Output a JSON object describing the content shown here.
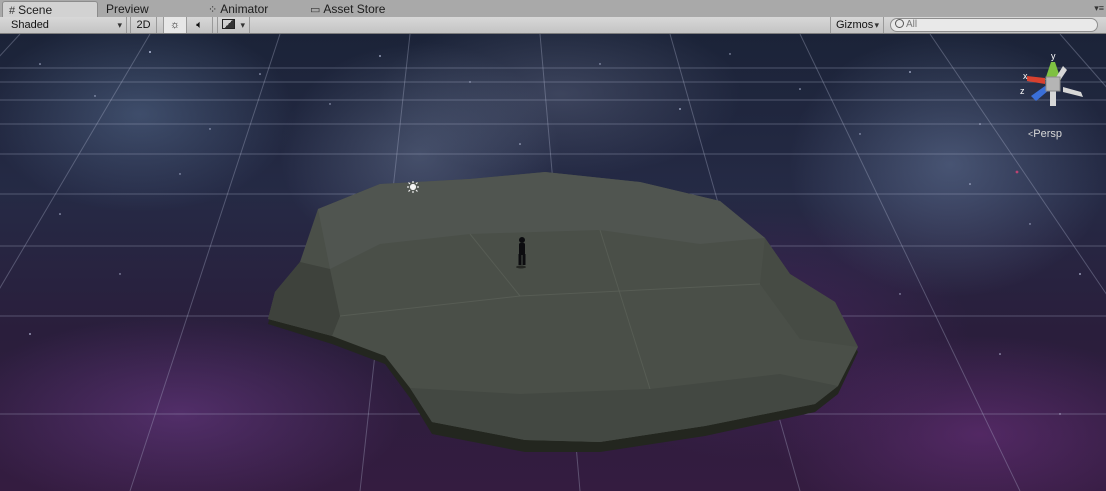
{
  "tabs": [
    {
      "label": "Scene",
      "icon": "grid-icon",
      "active": true
    },
    {
      "label": "Preview",
      "icon": "",
      "active": false
    },
    {
      "label": "Animator",
      "icon": "animator-icon",
      "active": false
    },
    {
      "label": "Asset Store",
      "icon": "store-icon",
      "active": false
    }
  ],
  "toolbar": {
    "draw_mode": "Shaded",
    "mode_2d": "2D",
    "gizmos": "Gizmos",
    "search_placeholder": "All"
  },
  "gizmo": {
    "projection": "Persp",
    "axis_y": "y",
    "axis_x": "x",
    "axis_z": "z"
  },
  "colors": {
    "axis_x": "#d8412f",
    "axis_y": "#7fc142",
    "axis_z": "#3a6fd8",
    "ground": "#4a4f48",
    "grid": "#b9bdd6"
  }
}
